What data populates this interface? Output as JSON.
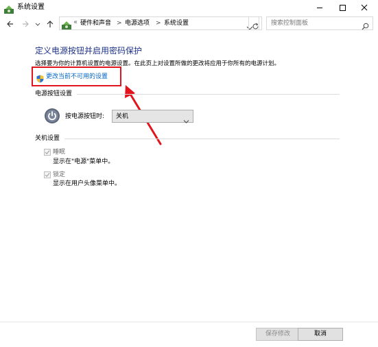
{
  "window": {
    "title": "系统设置",
    "controls": [
      "minimize-icon",
      "maximize-icon",
      "close-icon"
    ]
  },
  "nav": {
    "back_icon": "arrow-left-icon",
    "forward_icon": "arrow-right-icon",
    "up_icon": "arrow-up-icon",
    "address": {
      "overflow": "«",
      "crumbs": [
        "硬件和声音",
        "电源选项",
        "系统设置"
      ],
      "separator": ">"
    },
    "refresh_icon": "refresh-icon",
    "search": {
      "placeholder": "搜索控制面板",
      "icon": "search-icon"
    }
  },
  "main": {
    "heading": "定义电源按钮并启用密码保护",
    "description": "选择要为你的计算机设置的电源设置。在此页上对设置所做的更改将应用于你所有的电源计划。",
    "change_link": "更改当前不可用的设置",
    "power_section": {
      "title": "电源按钮设置",
      "label": "按电源按钮时:",
      "selected": "关机"
    },
    "shutdown_section": {
      "title": "关机设置",
      "items": [
        {
          "label": "睡眠",
          "desc": "显示在\"电源\"菜单中。",
          "checked": true
        },
        {
          "label": "锁定",
          "desc": "显示在用户头像菜单中。",
          "checked": true
        }
      ]
    }
  },
  "footer": {
    "save_label": "保存修改",
    "cancel_label": "取消"
  },
  "colors": {
    "heading": "#1e3287",
    "link": "#0066cc",
    "highlight": "#e1141e"
  }
}
